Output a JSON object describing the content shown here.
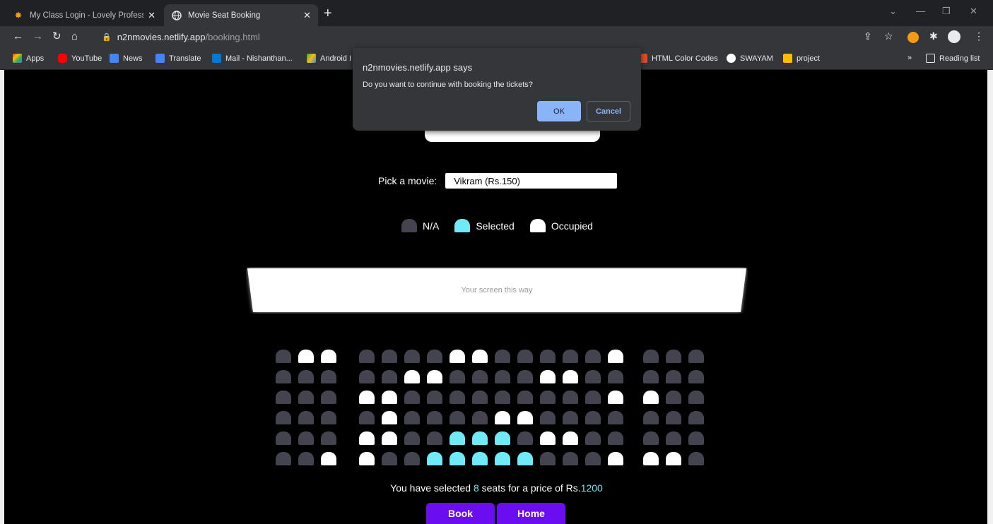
{
  "tabs": [
    {
      "title": "My Class Login - Lovely Professio",
      "icon": "lpu-logo-icon"
    },
    {
      "title": "Movie Seat Booking",
      "icon": "globe-icon"
    }
  ],
  "address": {
    "host": "n2nmovies.netlify.app",
    "path": "/booking.html"
  },
  "bookmarks": [
    {
      "label": "Apps",
      "color": "#ea4335"
    },
    {
      "label": "YouTube",
      "color": "#ff0000"
    },
    {
      "label": "News",
      "color": "#4285f4"
    },
    {
      "label": "Translate",
      "color": "#4285f4"
    },
    {
      "label": "Mail - Nishanthan...",
      "color": "#0078d4"
    },
    {
      "label": "Android I",
      "color": "#fbbc04"
    },
    {
      "label": "HTML Color Codes",
      "color": "#e34c26"
    },
    {
      "label": "SWAYAM",
      "color": "#ffffff"
    },
    {
      "label": "project",
      "color": "#fbbc04"
    }
  ],
  "bookmarks_more": "»",
  "reading_list": "Reading list",
  "dialog": {
    "title": "n2nmovies.netlify.app says",
    "message": "Do you want to continue with booking the tickets?",
    "ok": "OK",
    "cancel": "Cancel"
  },
  "movie_picker": {
    "label": "Pick a movie:",
    "selected": "Vikram (Rs.150)"
  },
  "legend": [
    {
      "label": "N/A",
      "color": "#444451"
    },
    {
      "label": "Selected",
      "color": "#6feaf6"
    },
    {
      "label": "Occupied",
      "color": "#ffffff"
    }
  ],
  "screen_text": "Your screen this way",
  "seat_rows": [
    [
      "na",
      "occ",
      "occ",
      "na",
      "na",
      "na",
      "na",
      "occ",
      "occ",
      "na",
      "na",
      "na",
      "na",
      "na",
      "occ",
      "na",
      "na",
      "na"
    ],
    [
      "na",
      "na",
      "na",
      "na",
      "na",
      "occ",
      "occ",
      "na",
      "na",
      "na",
      "na",
      "occ",
      "occ",
      "na",
      "na",
      "na",
      "na",
      "na"
    ],
    [
      "na",
      "na",
      "na",
      "occ",
      "occ",
      "na",
      "na",
      "na",
      "na",
      "na",
      "na",
      "na",
      "na",
      "na",
      "occ",
      "occ",
      "na",
      "na"
    ],
    [
      "na",
      "na",
      "na",
      "na",
      "occ",
      "na",
      "na",
      "na",
      "na",
      "occ",
      "occ",
      "na",
      "na",
      "na",
      "na",
      "na",
      "na",
      "na"
    ],
    [
      "na",
      "na",
      "na",
      "occ",
      "occ",
      "na",
      "na",
      "sel",
      "sel",
      "sel",
      "na",
      "occ",
      "occ",
      "na",
      "na",
      "na",
      "na",
      "na"
    ],
    [
      "na",
      "na",
      "occ",
      "occ",
      "na",
      "na",
      "sel",
      "sel",
      "sel",
      "sel",
      "sel",
      "na",
      "na",
      "na",
      "occ",
      "occ",
      "occ",
      "na"
    ]
  ],
  "summary": {
    "prefix": "You have selected ",
    "count": "8",
    "middle": " seats for a price of Rs.",
    "price": "1200"
  },
  "buttons": {
    "book": "Book",
    "home": "Home"
  }
}
